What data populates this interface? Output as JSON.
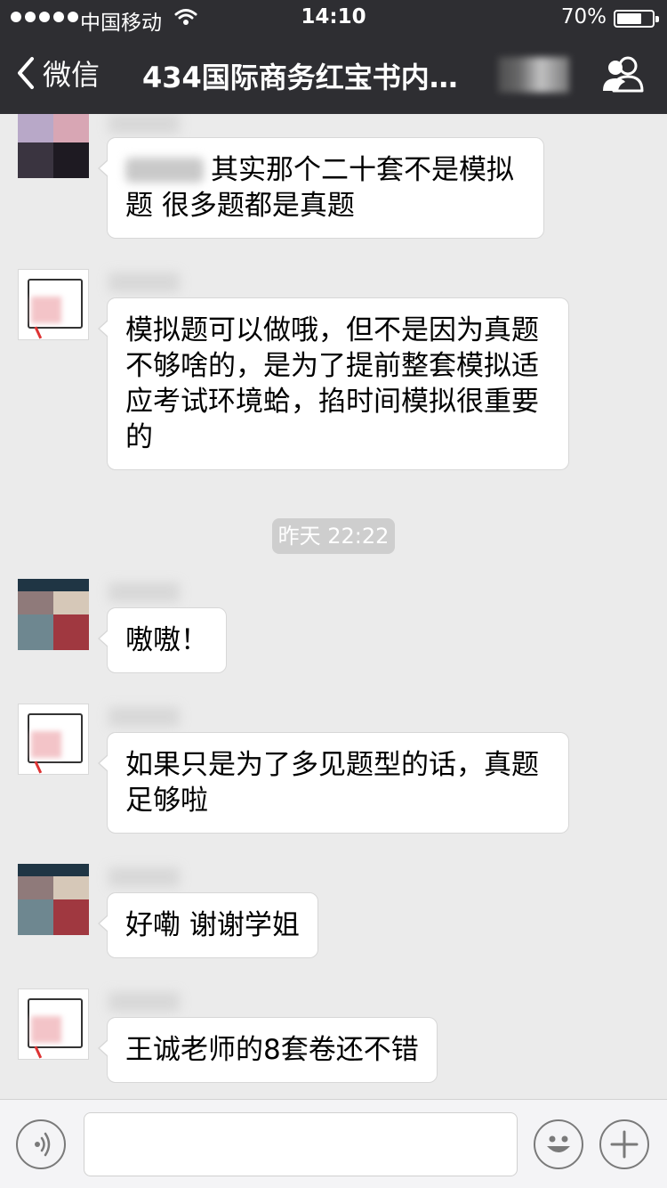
{
  "status_bar": {
    "carrier": "中国移动",
    "time": "14:10",
    "battery": "70%",
    "battery_level": 0.7
  },
  "nav": {
    "back_label": "微信",
    "title": "434国际商务红宝书内…",
    "group_icon": "group-members-icon"
  },
  "chat": {
    "timestamp": "昨天 22:22",
    "messages": [
      {
        "text": "其实那个二十套不是模拟题 很多题都是真题"
      },
      {
        "text": "模拟题可以做哦，但不是因为真题不够啥的，是为了提前整套模拟适应考试环境蛤，掐时间模拟很重要的"
      },
      {
        "text": "嗷嗷！"
      },
      {
        "text": "如果只是为了多见题型的话，真题足够啦"
      },
      {
        "text": "好嘞 谢谢学姐"
      },
      {
        "text": "王诚老师的8套卷还不错"
      }
    ]
  },
  "input_bar": {
    "voice_icon": "voice-icon",
    "emoji_icon": "emoji-icon",
    "plus_icon": "plus-icon",
    "text_value": ""
  }
}
